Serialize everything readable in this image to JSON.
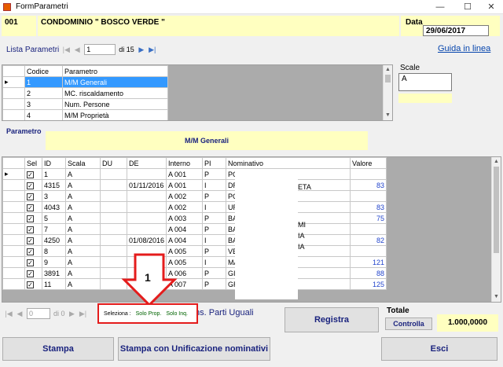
{
  "window": {
    "title": "FormParametri",
    "minimize": "—",
    "maximize": "☐",
    "close": "✕"
  },
  "header": {
    "code": "001",
    "condominio": "CONDOMINIO \" BOSCO VERDE \"",
    "data_label": "Data",
    "data_value": "29/06/2017"
  },
  "lista_nav": {
    "label": "Lista Parametri",
    "current": "1",
    "of_text": "di 15"
  },
  "guide_link": "Guida in linea",
  "param_grid": {
    "headers": [
      "Codice",
      "Parametro"
    ],
    "rows": [
      {
        "codice": "1",
        "parametro": "M/M Generali"
      },
      {
        "codice": "2",
        "parametro": "MC. riscaldamento"
      },
      {
        "codice": "3",
        "parametro": "Num. Persone"
      },
      {
        "codice": "4",
        "parametro": "M/M Proprietà"
      }
    ]
  },
  "scale": {
    "label": "Scale",
    "value": "A"
  },
  "parametro": {
    "label": "Parametro",
    "value": "M/M Generali"
  },
  "main_grid": {
    "headers": [
      "Sel",
      "ID",
      "Scala",
      "DU",
      "DE",
      "Interno",
      "PI",
      "Nominativo",
      "Valore"
    ],
    "rows": [
      {
        "id": "1",
        "scala": "A",
        "du": "",
        "de": "",
        "interno": "A 001",
        "pi": "P",
        "nominativo": "PO",
        "valore": ""
      },
      {
        "id": "4315",
        "scala": "A",
        "du": "",
        "de": "01/11/2016",
        "interno": "A 001",
        "pi": "I",
        "nominativo": "DR",
        "valore": "83"
      },
      {
        "id": "3",
        "scala": "A",
        "du": "",
        "de": "",
        "interno": "A 002",
        "pi": "P",
        "nominativo": "PO",
        "valore": ""
      },
      {
        "id": "4043",
        "scala": "A",
        "du": "",
        "de": "",
        "interno": "A 002",
        "pi": "I",
        "nominativo": "UR",
        "valore": "83"
      },
      {
        "id": "5",
        "scala": "A",
        "du": "",
        "de": "",
        "interno": "A 003",
        "pi": "P",
        "nominativo": "BA",
        "valore": "75"
      },
      {
        "id": "7",
        "scala": "A",
        "du": "",
        "de": "",
        "interno": "A 004",
        "pi": "P",
        "nominativo": "BA",
        "valore": ""
      },
      {
        "id": "4250",
        "scala": "A",
        "du": "",
        "de": "01/08/2016",
        "interno": "A 004",
        "pi": "I",
        "nominativo": "BA",
        "valore": "82"
      },
      {
        "id": "8",
        "scala": "A",
        "du": "",
        "de": "",
        "interno": "A 005",
        "pi": "P",
        "nominativo": "VE",
        "valore": ""
      },
      {
        "id": "9",
        "scala": "A",
        "du": "",
        "de": "",
        "interno": "A 005",
        "pi": "I",
        "nominativo": "MA",
        "valore": "121"
      },
      {
        "id": "3891",
        "scala": "A",
        "du": "",
        "de": "",
        "interno": "A 006",
        "pi": "P",
        "nominativo": "GIU",
        "valore": "88"
      },
      {
        "id": "11",
        "scala": "A",
        "du": "",
        "de": "",
        "interno": "A 007",
        "pi": "P",
        "nominativo": "GR",
        "valore": "125"
      }
    ],
    "fragments": [
      "ETA",
      "MI",
      "IA",
      "IA"
    ]
  },
  "bottom_nav": {
    "current": "0",
    "of_text": "di 0"
  },
  "seleziona": {
    "label": "Seleziona :",
    "solo_prop": "Solo Prop.",
    "solo_inq": "Solo Inq.",
    "behind_text": "ns. Parti Uguali"
  },
  "annotation": {
    "number": "1"
  },
  "buttons": {
    "registra": "Registra",
    "stampa": "Stampa",
    "stampa_unif": "Stampa con Unificazione nominativi",
    "esci": "Esci",
    "controlla": "Controlla"
  },
  "totale": {
    "label": "Totale",
    "value": "1.000,0000"
  },
  "colors": {
    "highlight": "#ffffc0",
    "selection": "#3399ff",
    "annotation_red": "#e41c1c"
  }
}
